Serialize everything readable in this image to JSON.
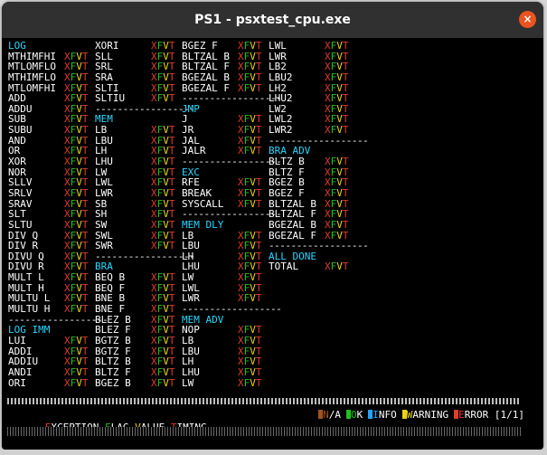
{
  "window": {
    "title": "PS1 - psxtest_cpu.exe",
    "close_glyph": "×"
  },
  "colors": {
    "section": "#28d7ff",
    "x": "#e13c2d",
    "f": "#20c020",
    "v": "#e8d21a",
    "t": "#e13c2d",
    "na": "#a0521e",
    "ok": "#20c020",
    "info": "#28a0ff",
    "warning": "#e8d21a",
    "error": "#e13c2d"
  },
  "result_marker": "XFVT",
  "columns": [
    [
      {
        "t": "s",
        "text": "LOG"
      },
      {
        "t": "r",
        "text": "MTHIMFHI"
      },
      {
        "t": "r",
        "text": "MTLOMFLO"
      },
      {
        "t": "r",
        "text": "MTHIMFLO"
      },
      {
        "t": "r",
        "text": "MTLOMFHI"
      },
      {
        "t": "r",
        "text": "ADD"
      },
      {
        "t": "r",
        "text": "ADDU"
      },
      {
        "t": "r",
        "text": "SUB"
      },
      {
        "t": "r",
        "text": "SUBU"
      },
      {
        "t": "r",
        "text": "AND"
      },
      {
        "t": "r",
        "text": "OR"
      },
      {
        "t": "r",
        "text": "XOR"
      },
      {
        "t": "r",
        "text": "NOR"
      },
      {
        "t": "r",
        "text": "SLLV"
      },
      {
        "t": "r",
        "text": "SRLV"
      },
      {
        "t": "r",
        "text": "SRAV"
      },
      {
        "t": "r",
        "text": "SLT"
      },
      {
        "t": "r",
        "text": "SLTU"
      },
      {
        "t": "r",
        "text": "DIV Q"
      },
      {
        "t": "r",
        "text": "DIV R"
      },
      {
        "t": "r",
        "text": "DIVU Q"
      },
      {
        "t": "r",
        "text": "DIVU R"
      },
      {
        "t": "r",
        "text": "MULT L"
      },
      {
        "t": "r",
        "text": "MULT H"
      },
      {
        "t": "r",
        "text": "MULTU L"
      },
      {
        "t": "r",
        "text": "MULTU H"
      },
      {
        "t": "d",
        "text": "------------------"
      },
      {
        "t": "s",
        "text": "LOG IMM"
      },
      {
        "t": "r",
        "text": "LUI"
      },
      {
        "t": "r",
        "text": "ADDI"
      },
      {
        "t": "r",
        "text": "ADDIU"
      },
      {
        "t": "r",
        "text": "ANDI"
      },
      {
        "t": "r",
        "text": "ORI"
      }
    ],
    [
      {
        "t": "r",
        "text": "XORI"
      },
      {
        "t": "r",
        "text": "SLL"
      },
      {
        "t": "r",
        "text": "SRL"
      },
      {
        "t": "r",
        "text": "SRA"
      },
      {
        "t": "r",
        "text": "SLTI"
      },
      {
        "t": "r",
        "text": "SLTIU"
      },
      {
        "t": "d",
        "text": "------------------"
      },
      {
        "t": "s",
        "text": "MEM"
      },
      {
        "t": "r",
        "text": "LB"
      },
      {
        "t": "r",
        "text": "LBU"
      },
      {
        "t": "r",
        "text": "LH"
      },
      {
        "t": "r",
        "text": "LHU"
      },
      {
        "t": "r",
        "text": "LW"
      },
      {
        "t": "r",
        "text": "LWL"
      },
      {
        "t": "r",
        "text": "LWR"
      },
      {
        "t": "r",
        "text": "SB"
      },
      {
        "t": "r",
        "text": "SH"
      },
      {
        "t": "r",
        "text": "SW"
      },
      {
        "t": "r",
        "text": "SWL"
      },
      {
        "t": "r",
        "text": "SWR"
      },
      {
        "t": "d",
        "text": "------------------"
      },
      {
        "t": "s",
        "text": "BRA"
      },
      {
        "t": "r",
        "text": "BEQ B"
      },
      {
        "t": "r",
        "text": "BEQ F"
      },
      {
        "t": "r",
        "text": "BNE B"
      },
      {
        "t": "r",
        "text": "BNE F"
      },
      {
        "t": "r",
        "text": "BLEZ B"
      },
      {
        "t": "r",
        "text": "BLEZ F"
      },
      {
        "t": "r",
        "text": "BGTZ B"
      },
      {
        "t": "r",
        "text": "BGTZ F"
      },
      {
        "t": "r",
        "text": "BLTZ B"
      },
      {
        "t": "r",
        "text": "BLTZ F"
      },
      {
        "t": "r",
        "text": "BGEZ B"
      }
    ],
    [
      {
        "t": "r",
        "text": "BGEZ F"
      },
      {
        "t": "r",
        "text": "BLTZAL B"
      },
      {
        "t": "r",
        "text": "BLTZAL F"
      },
      {
        "t": "r",
        "text": "BGEZAL B"
      },
      {
        "t": "r",
        "text": "BGEZAL F"
      },
      {
        "t": "d",
        "text": "------------------"
      },
      {
        "t": "s",
        "text": "JMP"
      },
      {
        "t": "r",
        "text": "J"
      },
      {
        "t": "r",
        "text": "JR"
      },
      {
        "t": "r",
        "text": "JAL"
      },
      {
        "t": "r",
        "text": "JALR"
      },
      {
        "t": "d",
        "text": "------------------"
      },
      {
        "t": "s",
        "text": "EXC"
      },
      {
        "t": "r",
        "text": "RFE"
      },
      {
        "t": "r",
        "text": "BREAK"
      },
      {
        "t": "r",
        "text": "SYSCALL"
      },
      {
        "t": "d",
        "text": "------------------"
      },
      {
        "t": "s",
        "text": "MEM DLY"
      },
      {
        "t": "r",
        "text": "LB"
      },
      {
        "t": "r",
        "text": "LBU"
      },
      {
        "t": "r",
        "text": "LH"
      },
      {
        "t": "r",
        "text": "LHU"
      },
      {
        "t": "r",
        "text": "LW"
      },
      {
        "t": "r",
        "text": "LWL"
      },
      {
        "t": "r",
        "text": "LWR"
      },
      {
        "t": "d",
        "text": "------------------"
      },
      {
        "t": "s",
        "text": "MEM ADV"
      },
      {
        "t": "r",
        "text": "NOP"
      },
      {
        "t": "r",
        "text": "LB"
      },
      {
        "t": "r",
        "text": "LBU"
      },
      {
        "t": "r",
        "text": "LH"
      },
      {
        "t": "r",
        "text": "LHU"
      },
      {
        "t": "r",
        "text": "LW"
      }
    ],
    [
      {
        "t": "r",
        "text": "LWL"
      },
      {
        "t": "r",
        "text": "LWR"
      },
      {
        "t": "r",
        "text": "LB2"
      },
      {
        "t": "r",
        "text": "LBU2"
      },
      {
        "t": "r",
        "text": "LH2"
      },
      {
        "t": "r",
        "text": "LHU2"
      },
      {
        "t": "r",
        "text": "LW2"
      },
      {
        "t": "r",
        "text": "LWL2"
      },
      {
        "t": "r",
        "text": "LWR2"
      },
      {
        "t": "d",
        "text": "------------------"
      },
      {
        "t": "s",
        "text": "BRA ADV"
      },
      {
        "t": "r",
        "text": "BLTZ B"
      },
      {
        "t": "r",
        "text": "BLTZ F"
      },
      {
        "t": "r",
        "text": "BGEZ B"
      },
      {
        "t": "r",
        "text": "BGEZ F"
      },
      {
        "t": "r",
        "text": "BLTZAL B"
      },
      {
        "t": "r",
        "text": "BLTZAL F"
      },
      {
        "t": "r",
        "text": "BGEZAL B"
      },
      {
        "t": "r",
        "text": "BGEZAL F"
      },
      {
        "t": "d",
        "text": "------------------"
      },
      {
        "t": "s",
        "text": "ALL DONE"
      },
      {
        "t": "r",
        "text": "TOTAL"
      }
    ]
  ],
  "footer": {
    "legend_key": [
      {
        "initial": "E",
        "rest": "XCEPTION ",
        "color": "#e13c2d"
      },
      {
        "initial": "F",
        "rest": "LAG ",
        "color": "#20c020"
      },
      {
        "initial": "V",
        "rest": "ALUE ",
        "color": "#e8d21a"
      },
      {
        "initial": "T",
        "rest": "IMING",
        "color": "#e13c2d"
      }
    ],
    "status_legend": [
      {
        "initial": "N",
        "rest": "/A",
        "color": "#a0521e"
      },
      {
        "initial": "O",
        "rest": "K",
        "color": "#20c020"
      },
      {
        "initial": "I",
        "rest": "NFO",
        "color": "#28a0ff"
      },
      {
        "initial": "W",
        "rest": "ARNING",
        "color": "#e8d21a"
      },
      {
        "initial": "E",
        "rest": "RROR",
        "color": "#e13c2d"
      }
    ],
    "page": "[1/1]"
  }
}
